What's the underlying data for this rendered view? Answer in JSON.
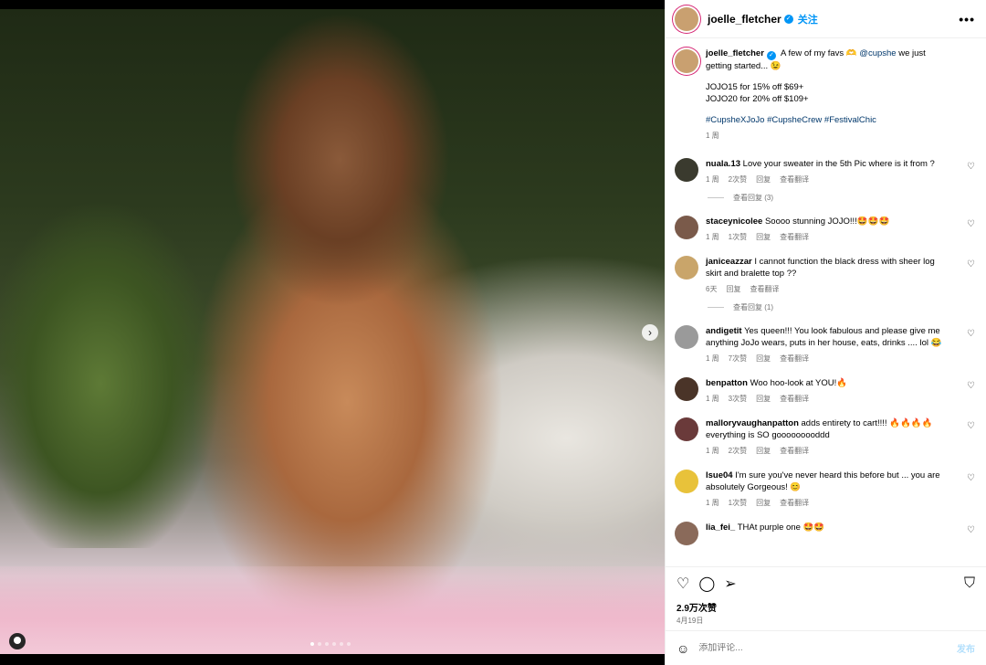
{
  "post": {
    "author": "joelle_fletcher",
    "follow_label": "关注",
    "more_label": "•••",
    "caption_lines": [
      "A few of my favs 🫶",
      "@cupshe",
      "we just getting started... 😉"
    ],
    "codes": [
      "JOJO15 for 15% off $69+",
      "JOJO20 for 20% off $109+"
    ],
    "hashtags": "#CupsheXJoJo #CupsheCrew #FestivalChic",
    "caption_time": "1 周"
  },
  "comments": [
    {
      "user": "nuala.13",
      "text": "Love your sweater in the 5th Pic where is it from ?",
      "time": "1 周",
      "likes": "2次赞",
      "reply": "回复",
      "translate": "查看翻译",
      "view_replies": "查看回复 (3)",
      "avatar_color": "#3a3a2e"
    },
    {
      "user": "staceynicolee",
      "text": "Soooo stunning JOJO!!!🤩🤩🤩",
      "time": "1 周",
      "likes": "1次赞",
      "reply": "回复",
      "translate": "查看翻译",
      "view_replies": "",
      "avatar_color": "#7a5a4a"
    },
    {
      "user": "janiceazzar",
      "text": "I cannot function the black dress with sheer log skirt and bralette top ??",
      "time": "6天",
      "likes": "",
      "reply": "回复",
      "translate": "查看翻译",
      "view_replies": "查看回复 (1)",
      "avatar_color": "#c9a56a"
    },
    {
      "user": "andigetit",
      "text": "Yes queen!!! You look fabulous and please give me anything JoJo wears, puts in her house, eats, drinks .... lol 😂",
      "time": "1 周",
      "likes": "7次赞",
      "reply": "回复",
      "translate": "查看翻译",
      "view_replies": "",
      "avatar_color": "#9a9a9a"
    },
    {
      "user": "benpatton",
      "text": "Woo hoo-look at YOU!🔥",
      "time": "1 周",
      "likes": "3次赞",
      "reply": "回复",
      "translate": "查看翻译",
      "view_replies": "",
      "avatar_color": "#4a3428"
    },
    {
      "user": "malloryvaughanpatton",
      "text": "adds entirety to cart!!!! 🔥🔥🔥🔥 everything is SO gooooooooddd",
      "time": "1 周",
      "likes": "2次赞",
      "reply": "回复",
      "translate": "查看翻译",
      "view_replies": "",
      "avatar_color": "#6a3a3a"
    },
    {
      "user": "lsue04",
      "text": "I'm sure you've never heard this before but ... you are absolutely Gorgeous! 😊",
      "time": "1 周",
      "likes": "1次赞",
      "reply": "回复",
      "translate": "查看翻译",
      "view_replies": "",
      "avatar_color": "#e8c23a"
    },
    {
      "user": "lia_fei_",
      "text": "THAt purple one 🤩🤩",
      "time": "",
      "likes": "",
      "reply": "",
      "translate": "",
      "view_replies": "",
      "avatar_color": "#8a6a5a"
    }
  ],
  "actions": {
    "like_icon": "heart-icon",
    "comment_icon": "comment-icon",
    "share_icon": "share-icon",
    "save_icon": "bookmark-icon",
    "likes_count": "2.9万次赞",
    "date": "4月19日"
  },
  "add_comment": {
    "placeholder": "添加评论...",
    "post_label": "发布"
  },
  "colors": {
    "accent": "#0095f6",
    "hashtag": "#00376b",
    "ring": "#d62976"
  }
}
